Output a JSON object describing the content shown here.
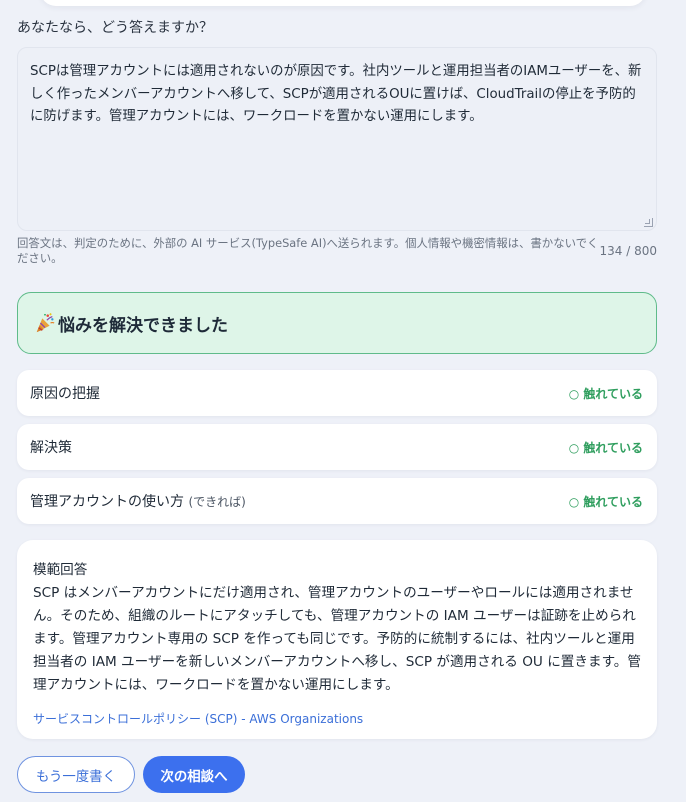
{
  "question": "あなたなら、どう答えますか？",
  "answer": {
    "value": "SCPは管理アカウントには適用されないのが原因です。社内ツールと運用担当者のIAMユーザーを、新しく作ったメンバーアカウントへ移して、SCPが適用されるOUに置けば、CloudTrailの停止を予防的に防げます。管理アカウントには、ワークロードを置かない運用にします。",
    "notice": "回答文は、判定のために、外部の AI サービス(TypeSafe AI)へ送られます。個人情報や機密情報は、書かないでください。",
    "counter": "134 / 800"
  },
  "result": {
    "title": "悩みを解決できました",
    "icon": "party-popper-icon",
    "accent_color": "#5fbb8a",
    "background_color": "#def5e8"
  },
  "criteria": [
    {
      "label": "原因の把握",
      "note": "",
      "status": "○ 触れている"
    },
    {
      "label": "解決策",
      "note": "",
      "status": "○ 触れている"
    },
    {
      "label": "管理アカウントの使い方",
      "note": "(できれば)",
      "status": "○ 触れている"
    }
  ],
  "model_answer": {
    "heading": "模範回答",
    "body": "SCP はメンバーアカウントにだけ適用され、管理アカウントのユーザーやロールには適用されません。そのため、組織のルートにアタッチしても、管理アカウントの IAM ユーザーは証跡を止められます。管理アカウント専用の SCP を作っても同じです。予防的に統制するには、社内ツールと運用担当者の IAM ユーザーを新しいメンバーアカウントへ移し、SCP が適用される OU に置きます。管理アカウントには、ワークロードを置かない運用にします。",
    "link": "サービスコントロールポリシー (SCP) - AWS Organizations"
  },
  "buttons": {
    "retry": "もう一度書く",
    "next": "次の相談へ"
  },
  "colors": {
    "status_green": "#2f9e5e",
    "primary_blue": "#3c70ee",
    "link_blue": "#3b6fd8"
  }
}
